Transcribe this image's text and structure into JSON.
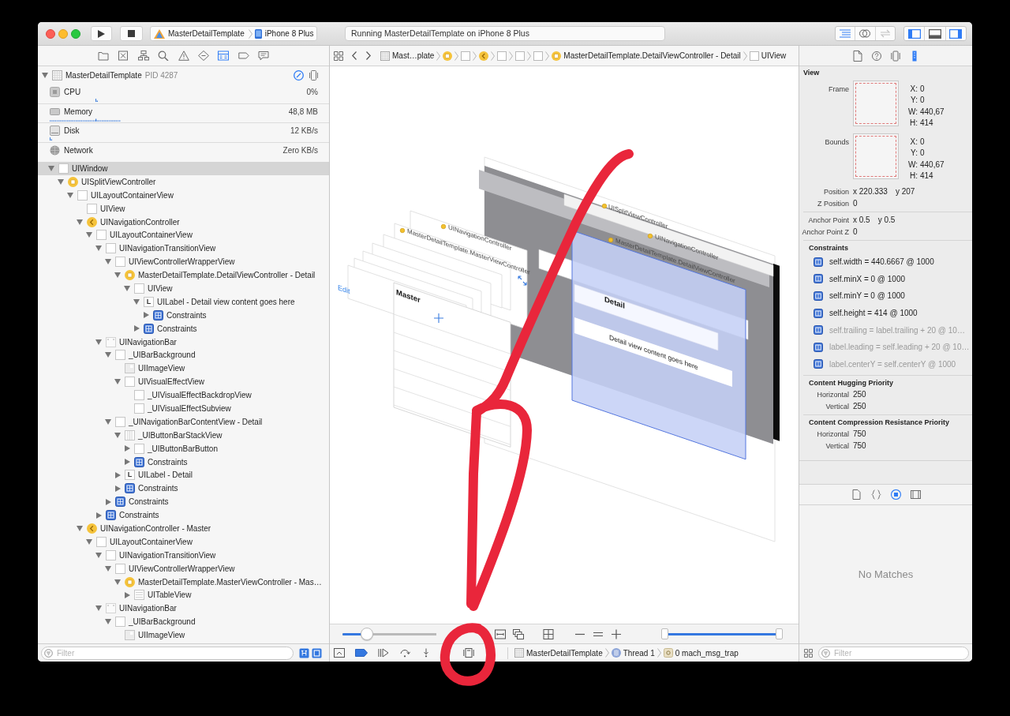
{
  "toolbar": {
    "scheme": "MasterDetailTemplate",
    "destination": "iPhone 8 Plus",
    "activity": "Running MasterDetailTemplate on iPhone 8 Plus",
    "editor_modes": [
      {
        "selected": true,
        "disabled": false
      },
      {
        "selected": false,
        "disabled": false
      },
      {
        "selected": false,
        "disabled": true
      }
    ],
    "panel_toggles": [
      {
        "on": true
      },
      {
        "on": false
      },
      {
        "on": true
      }
    ]
  },
  "navigator": {
    "tabs": [
      {
        "selected": false
      },
      {
        "selected": false
      },
      {
        "selected": false
      },
      {
        "selected": false
      },
      {
        "selected": false
      },
      {
        "selected": false
      },
      {
        "selected": true
      },
      {
        "selected": false
      },
      {
        "selected": false
      }
    ],
    "process": {
      "name": "MasterDetailTemplate",
      "pid": "PID 4287",
      "expanded": true
    },
    "gauges": [
      {
        "label": "CPU",
        "value": "0%"
      },
      {
        "label": "Memory",
        "value": "48,8 MB"
      },
      {
        "label": "Disk",
        "value": "12 KB/s"
      },
      {
        "label": "Network",
        "value": "Zero KB/s"
      }
    ],
    "tree": [
      {
        "label": "UIWindow",
        "kind": "window",
        "selected": true,
        "expanded": true,
        "children": [
          {
            "label": "UISplitViewController",
            "kind": "controller",
            "selected": false,
            "expanded": true,
            "children": [
              {
                "label": "UILayoutContainerView",
                "kind": "view",
                "selected": false,
                "expanded": true,
                "children": [
                  {
                    "label": "UIView",
                    "kind": "view",
                    "selected": false
                  },
                  {
                    "label": "UINavigationController",
                    "kind": "nav-controller",
                    "selected": false,
                    "expanded": true,
                    "children": [
                      {
                        "label": "UILayoutContainerView",
                        "kind": "view",
                        "selected": false,
                        "expanded": true,
                        "children": [
                          {
                            "label": "UINavigationTransitionView",
                            "kind": "view",
                            "selected": false,
                            "expanded": true,
                            "children": [
                              {
                                "label": "UIViewControllerWrapperView",
                                "kind": "view",
                                "selected": false,
                                "expanded": true,
                                "children": [
                                  {
                                    "label": "MasterDetailTemplate.DetailViewController - Detail",
                                    "kind": "controller",
                                    "selected": false,
                                    "expanded": true,
                                    "children": [
                                      {
                                        "label": "UIView",
                                        "kind": "view",
                                        "selected": false,
                                        "expanded": true,
                                        "children": [
                                          {
                                            "label": "UILabel - Detail view content goes here",
                                            "kind": "label",
                                            "badge": "L",
                                            "selected": false,
                                            "expanded": true,
                                            "children": [
                                              {
                                                "label": "Constraints",
                                                "kind": "constraints",
                                                "selected": false,
                                                "expanded": false
                                              }
                                            ]
                                          },
                                          {
                                            "label": "Constraints",
                                            "kind": "constraints",
                                            "selected": false,
                                            "expanded": false
                                          }
                                        ]
                                      }
                                    ]
                                  }
                                ]
                              }
                            ]
                          },
                          {
                            "label": "UINavigationBar",
                            "kind": "navbar",
                            "selected": false,
                            "expanded": true,
                            "children": [
                              {
                                "label": "_UIBarBackground",
                                "kind": "view",
                                "selected": false,
                                "expanded": true,
                                "children": [
                                  {
                                    "label": "UIImageView",
                                    "kind": "image",
                                    "selected": false
                                  },
                                  {
                                    "label": "UIVisualEffectView",
                                    "kind": "view",
                                    "selected": false,
                                    "expanded": true,
                                    "children": [
                                      {
                                        "label": "_UIVisualEffectBackdropView",
                                        "kind": "view",
                                        "selected": false
                                      },
                                      {
                                        "label": "_UIVisualEffectSubview",
                                        "kind": "view",
                                        "selected": false
                                      }
                                    ]
                                  }
                                ]
                              },
                              {
                                "label": "_UINavigationBarContentView - Detail",
                                "kind": "view",
                                "selected": false,
                                "expanded": true,
                                "children": [
                                  {
                                    "label": "_UIButtonBarStackView",
                                    "kind": "stack",
                                    "selected": false,
                                    "expanded": true,
                                    "children": [
                                      {
                                        "label": "_UIButtonBarButton",
                                        "kind": "view",
                                        "selected": false,
                                        "expanded": false
                                      },
                                      {
                                        "label": "Constraints",
                                        "kind": "constraints",
                                        "selected": false,
                                        "expanded": false
                                      }
                                    ]
                                  },
                                  {
                                    "label": "UILabel - Detail",
                                    "kind": "label",
                                    "badge": "L",
                                    "selected": false,
                                    "expanded": false
                                  },
                                  {
                                    "label": "Constraints",
                                    "kind": "constraints",
                                    "selected": false,
                                    "expanded": false
                                  }
                                ]
                              },
                              {
                                "label": "Constraints",
                                "kind": "constraints",
                                "selected": false,
                                "expanded": false
                              }
                            ]
                          },
                          {
                            "label": "Constraints",
                            "kind": "constraints",
                            "selected": false,
                            "expanded": false
                          }
                        ]
                      }
                    ]
                  },
                  {
                    "label": "UINavigationController - Master",
                    "kind": "nav-controller",
                    "selected": false,
                    "expanded": true,
                    "children": [
                      {
                        "label": "UILayoutContainerView",
                        "kind": "view",
                        "selected": false,
                        "expanded": true,
                        "children": [
                          {
                            "label": "UINavigationTransitionView",
                            "kind": "view",
                            "selected": false,
                            "expanded": true,
                            "children": [
                              {
                                "label": "UIViewControllerWrapperView",
                                "kind": "view",
                                "selected": false,
                                "expanded": true,
                                "children": [
                                  {
                                    "label": "MasterDetailTemplate.MasterViewController - Mas…",
                                    "kind": "controller",
                                    "selected": false,
                                    "expanded": true,
                                    "children": [
                                      {
                                        "label": "UITableView",
                                        "kind": "table",
                                        "selected": false,
                                        "expanded": false
                                      }
                                    ]
                                  }
                                ]
                              }
                            ]
                          },
                          {
                            "label": "UINavigationBar",
                            "kind": "navbar",
                            "selected": false,
                            "expanded": true,
                            "children": [
                              {
                                "label": "_UIBarBackground",
                                "kind": "view",
                                "selected": false,
                                "expanded": true,
                                "children": [
                                  {
                                    "label": "UIImageView",
                                    "kind": "image",
                                    "selected": false
                                  }
                                ]
                              }
                            ]
                          }
                        ]
                      }
                    ]
                  }
                ]
              }
            ]
          }
        ]
      }
    ],
    "filter": {
      "placeholder": "Filter"
    },
    "filter_toggles": [
      {
        "on": true
      },
      {
        "on": true
      }
    ]
  },
  "jump_bar": {
    "crumbs": [
      {
        "kind": "project",
        "label": "Mast…plate"
      },
      {
        "kind": "controller"
      },
      {
        "kind": "view"
      },
      {
        "kind": "nav-controller"
      },
      {
        "kind": "view"
      },
      {
        "kind": "view"
      },
      {
        "kind": "view"
      },
      {
        "kind": "controller",
        "label": "MasterDetailTemplate.DetailViewController - Detail"
      },
      {
        "kind": "view",
        "label": "UIView"
      }
    ]
  },
  "canvas": {
    "layer_titles": [
      {
        "label": "UISplitViewController"
      },
      {
        "label": "UINavigationController"
      },
      {
        "label": "MasterDetailTemplate.DetailViewController"
      },
      {
        "label": "UINavigationController"
      },
      {
        "label": "MasterDetailTemplate.MasterViewController"
      }
    ],
    "screen_texts": [
      {
        "kind": "button",
        "label": "Edit"
      },
      {
        "kind": "title",
        "label": "Master"
      },
      {
        "kind": "title",
        "label": "Detail"
      },
      {
        "kind": "body",
        "label": "Detail view content goes here"
      }
    ]
  },
  "canvas_bar": {
    "spacing_slider": {
      "level": 0.22
    },
    "range_slider": {
      "thumbs": [
        {
          "level": 0
        },
        {
          "level": 1
        }
      ]
    }
  },
  "debug_bar": {
    "breakpoints_on": true,
    "crumbs": [
      {
        "kind": "project",
        "label": "MasterDetailTemplate"
      },
      {
        "kind": "thread",
        "label": "Thread 1"
      },
      {
        "kind": "frame",
        "label": "0 mach_msg_trap"
      }
    ]
  },
  "inspector": {
    "tabs": [
      {
        "selected": false
      },
      {
        "selected": false
      },
      {
        "selected": false
      },
      {
        "selected": true
      }
    ],
    "title": "View",
    "rects": [
      {
        "label": "Frame",
        "fields": [
          {
            "label": "X:",
            "value": "0"
          },
          {
            "label": "Y:",
            "value": "0"
          },
          {
            "label": "W:",
            "value": "440,67"
          },
          {
            "label": "H:",
            "value": "414"
          }
        ]
      },
      {
        "label": "Bounds",
        "fields": [
          {
            "label": "X:",
            "value": "0"
          },
          {
            "label": "Y:",
            "value": "0"
          },
          {
            "label": "W:",
            "value": "440,67"
          },
          {
            "label": "H:",
            "value": "414"
          }
        ]
      }
    ],
    "property_groups": [
      {
        "rows": [
          {
            "label": "Position",
            "values": [
              "x 220.333",
              "y 207"
            ]
          },
          {
            "label": "Z Position",
            "values": [
              "0"
            ]
          }
        ]
      },
      {
        "rows": [
          {
            "label": "Anchor Point",
            "values": [
              "x 0.5",
              "y 0.5"
            ]
          },
          {
            "label": "Anchor Point Z",
            "values": [
              "0"
            ]
          }
        ]
      }
    ],
    "constraints": {
      "title": "Constraints",
      "items": [
        {
          "text": "self.width = 440.6667 @ 1000",
          "active": true
        },
        {
          "text": "self.minX = 0 @ 1000",
          "active": true
        },
        {
          "text": "self.minY = 0 @ 1000",
          "active": true
        },
        {
          "text": "self.height = 414 @ 1000",
          "active": true
        },
        {
          "text": "self.trailing = label.trailing + 20 @ 10…",
          "active": false
        },
        {
          "text": "label.leading = self.leading + 20 @ 10…",
          "active": false
        },
        {
          "text": "label.centerY = self.centerY @ 1000",
          "active": false
        }
      ]
    },
    "priorities": [
      {
        "title": "Content Hugging Priority",
        "rows": [
          {
            "label": "Horizontal",
            "value": "250"
          },
          {
            "label": "Vertical",
            "value": "250"
          }
        ]
      },
      {
        "title": "Content Compression Resistance Priority",
        "rows": [
          {
            "label": "Horizontal",
            "value": "750"
          },
          {
            "label": "Vertical",
            "value": "750"
          }
        ]
      }
    ]
  },
  "library": {
    "tabs": [
      {
        "selected": false
      },
      {
        "selected": false
      },
      {
        "selected": true
      },
      {
        "selected": false
      }
    ],
    "empty_text": "No Matches",
    "filter": {
      "placeholder": "Filter"
    }
  }
}
